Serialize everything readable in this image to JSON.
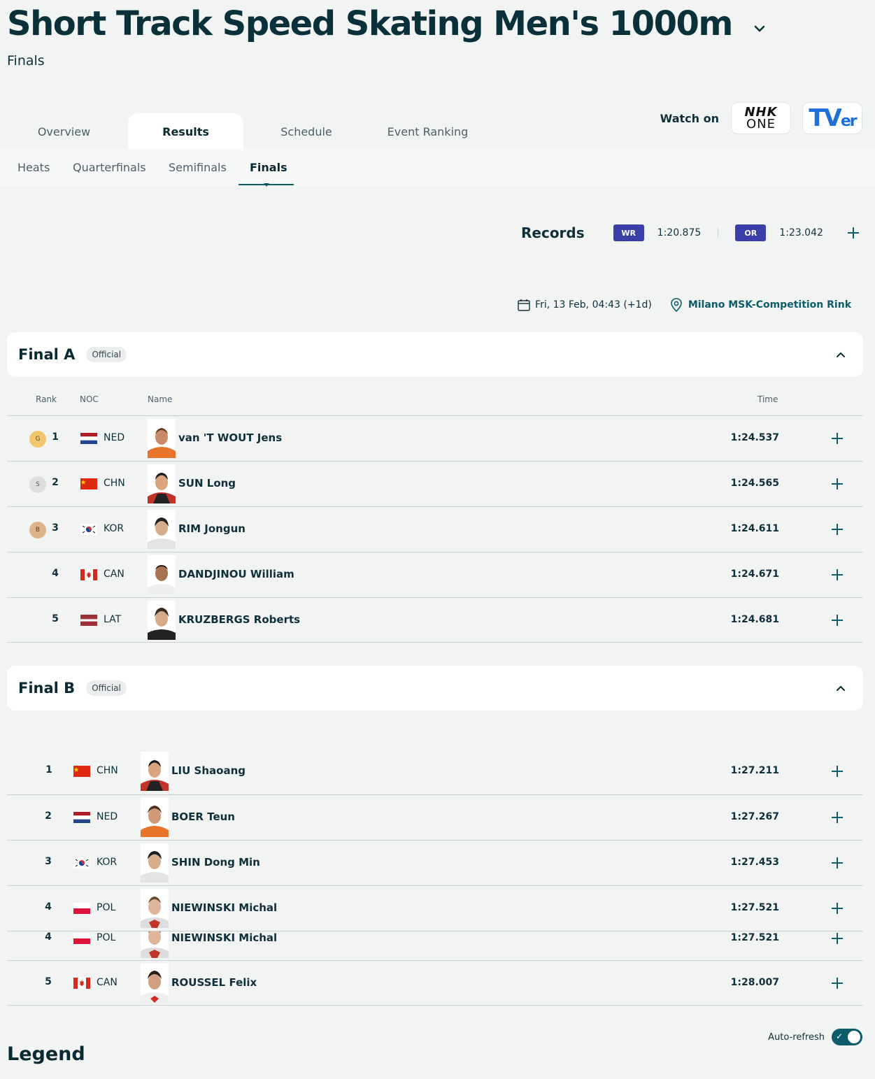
{
  "header": {
    "title": "Short Track Speed Skating Men's 1000m",
    "subtitle": "Finals"
  },
  "tabs": [
    {
      "label": "Overview"
    },
    {
      "label": "Results"
    },
    {
      "label": "Schedule"
    },
    {
      "label": "Event Ranking"
    }
  ],
  "active_tab": "Results",
  "watch": {
    "label": "Watch on",
    "logos": [
      {
        "top": "NHK",
        "bottom": "ONE"
      },
      {
        "text": "TV",
        "suffix": "er"
      }
    ]
  },
  "subtabs": [
    {
      "label": "Heats"
    },
    {
      "label": "Quarterfinals"
    },
    {
      "label": "Semifinals"
    },
    {
      "label": "Finals"
    }
  ],
  "active_subtab": "Finals",
  "records": {
    "label": "Records",
    "wr": {
      "badge": "WR",
      "value": "1:20.875"
    },
    "or": {
      "badge": "OR",
      "value": "1:23.042"
    }
  },
  "event_info": {
    "datetime": "Fri, 13 Feb, 04:43 (+1d)",
    "venue": "Milano MSK-Competition Rink"
  },
  "columns": {
    "rank": "Rank",
    "noc": "NOC",
    "name": "Name",
    "time": "Time"
  },
  "final_a": {
    "title": "Final A",
    "status": "Official",
    "rows": [
      {
        "medal": "G",
        "rank": "1",
        "noc": "NED",
        "name": "van 'T WOUT Jens",
        "time": "1:24.537"
      },
      {
        "medal": "S",
        "rank": "2",
        "noc": "CHN",
        "name": "SUN Long",
        "time": "1:24.565"
      },
      {
        "medal": "B",
        "rank": "3",
        "noc": "KOR",
        "name": "RIM Jongun",
        "time": "1:24.611"
      },
      {
        "medal": "",
        "rank": "4",
        "noc": "CAN",
        "name": "DANDJINOU William",
        "time": "1:24.671"
      },
      {
        "medal": "",
        "rank": "5",
        "noc": "LAT",
        "name": "KRUZBERGS Roberts",
        "time": "1:24.681"
      }
    ]
  },
  "final_b": {
    "title": "Final B",
    "status": "Official",
    "rows": [
      {
        "rank": "1",
        "noc": "CHN",
        "name": "LIU Shaoang",
        "time": "1:27.211"
      },
      {
        "rank": "2",
        "noc": "NED",
        "name": "BOER Teun",
        "time": "1:27.267"
      },
      {
        "rank": "3",
        "noc": "KOR",
        "name": "SHIN Dong Min",
        "time": "1:27.453"
      },
      {
        "rank": "4",
        "noc": "POL",
        "name": "NIEWINSKI Michal",
        "time": "1:27.521"
      },
      {
        "rank": "4",
        "noc": "POL",
        "name": "NIEWINSKI Michal",
        "time": "1:27.521"
      },
      {
        "rank": "5",
        "noc": "CAN",
        "name": "ROUSSEL Felix",
        "time": "1:28.007"
      }
    ]
  },
  "auto_refresh": {
    "label": "Auto-refresh",
    "enabled": true
  },
  "legend": {
    "title": "Legend"
  },
  "colors": {
    "accent": "#0d5c6b",
    "record_badge": "#3a3fa8",
    "gold": "#f2c66d",
    "silver": "#dedede",
    "bronze": "#ddb38a"
  }
}
